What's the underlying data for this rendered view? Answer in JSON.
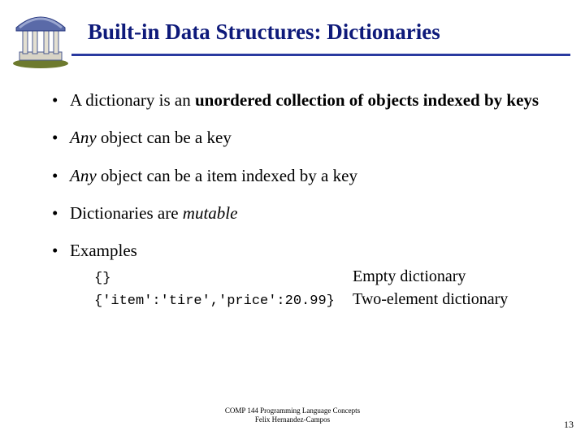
{
  "title": "Built-in Data Structures: Dictionaries",
  "bullets": {
    "b1_pre": "A dictionary is an ",
    "b1_bold": "unordered collection of objects indexed by keys",
    "b2_pre": "Any",
    "b2_rest": " object can be a key",
    "b3_pre": "Any",
    "b3_rest": " object can be a item indexed by a key",
    "b4_pre": "Dictionaries are ",
    "b4_it": "mutable",
    "b5": "Examples"
  },
  "examples": {
    "r1_code": "{}",
    "r1_desc": "Empty dictionary",
    "r2_code": "{'item':'tire','price':20.99}",
    "r2_desc": "Two-element dictionary"
  },
  "footer": {
    "line1": "COMP 144 Programming Language Concepts",
    "line2": "Felix Hernandez-Campos"
  },
  "pagenum": "13"
}
